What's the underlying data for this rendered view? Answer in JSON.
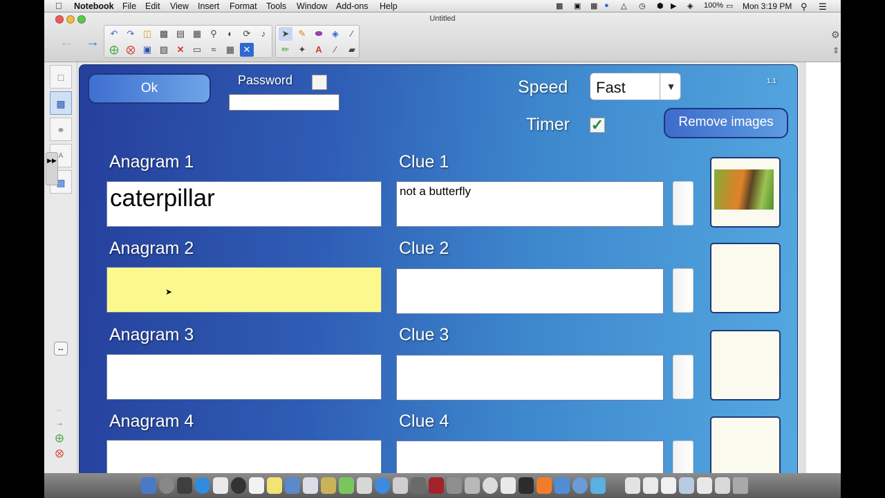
{
  "menubar": {
    "app_name": "Notebook",
    "items": [
      "File",
      "Edit",
      "View",
      "Insert",
      "Format",
      "Tools",
      "Window",
      "Add-ons",
      "Help"
    ],
    "battery": "100%",
    "clock": "Mon 3:19 PM"
  },
  "window": {
    "title": "Untitled"
  },
  "form": {
    "ok_label": "Ok",
    "password_label": "Password",
    "password_value": "",
    "speed_label": "Speed",
    "speed_value": "Fast",
    "timer_label": "Timer",
    "timer_checked": true,
    "remove_images_label": "Remove images",
    "version": "1.1",
    "rows": [
      {
        "anagram_label": "Anagram 1",
        "anagram_value": "caterpillar",
        "clue_label": "Clue 1",
        "clue_value": "not a butterfly",
        "has_image": true
      },
      {
        "anagram_label": "Anagram 2",
        "anagram_value": "",
        "clue_label": "Clue 2",
        "clue_value": "",
        "has_image": false
      },
      {
        "anagram_label": "Anagram 3",
        "anagram_value": "",
        "clue_label": "Clue 3",
        "clue_value": "",
        "has_image": false
      },
      {
        "anagram_label": "Anagram 4",
        "anagram_value": "",
        "clue_label": "Clue 4",
        "clue_value": "",
        "has_image": false
      }
    ]
  },
  "colors": {
    "canvas_dark": "#253f9b",
    "canvas_light": "#55a8e0",
    "active_field": "#fbf98e",
    "field_border": "#6a7fa8"
  },
  "icons": {
    "check": "✓",
    "dropdown": "▼",
    "back": "←",
    "forward": "→"
  }
}
